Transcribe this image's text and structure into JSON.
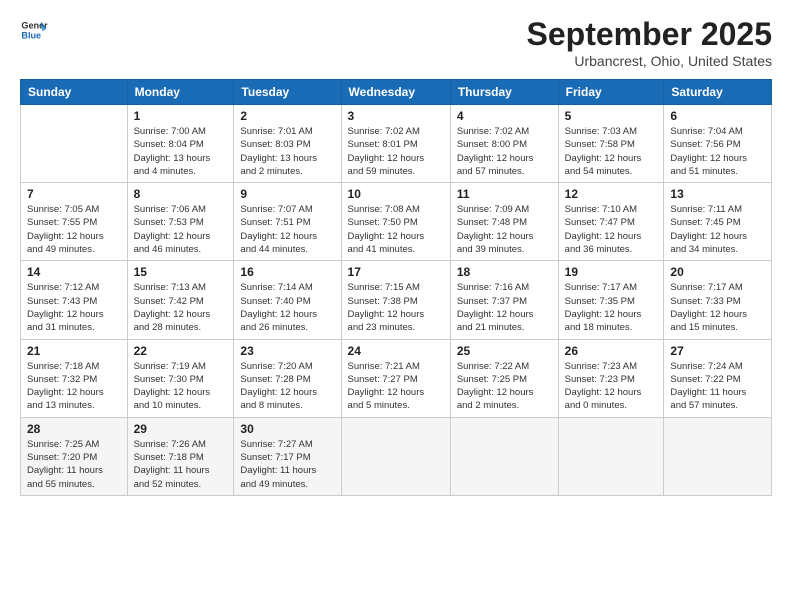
{
  "header": {
    "logo_line1": "General",
    "logo_line2": "Blue",
    "month": "September 2025",
    "location": "Urbancrest, Ohio, United States"
  },
  "weekdays": [
    "Sunday",
    "Monday",
    "Tuesday",
    "Wednesday",
    "Thursday",
    "Friday",
    "Saturday"
  ],
  "weeks": [
    [
      {
        "day": "",
        "info": ""
      },
      {
        "day": "1",
        "info": "Sunrise: 7:00 AM\nSunset: 8:04 PM\nDaylight: 13 hours\nand 4 minutes."
      },
      {
        "day": "2",
        "info": "Sunrise: 7:01 AM\nSunset: 8:03 PM\nDaylight: 13 hours\nand 2 minutes."
      },
      {
        "day": "3",
        "info": "Sunrise: 7:02 AM\nSunset: 8:01 PM\nDaylight: 12 hours\nand 59 minutes."
      },
      {
        "day": "4",
        "info": "Sunrise: 7:02 AM\nSunset: 8:00 PM\nDaylight: 12 hours\nand 57 minutes."
      },
      {
        "day": "5",
        "info": "Sunrise: 7:03 AM\nSunset: 7:58 PM\nDaylight: 12 hours\nand 54 minutes."
      },
      {
        "day": "6",
        "info": "Sunrise: 7:04 AM\nSunset: 7:56 PM\nDaylight: 12 hours\nand 51 minutes."
      }
    ],
    [
      {
        "day": "7",
        "info": "Sunrise: 7:05 AM\nSunset: 7:55 PM\nDaylight: 12 hours\nand 49 minutes."
      },
      {
        "day": "8",
        "info": "Sunrise: 7:06 AM\nSunset: 7:53 PM\nDaylight: 12 hours\nand 46 minutes."
      },
      {
        "day": "9",
        "info": "Sunrise: 7:07 AM\nSunset: 7:51 PM\nDaylight: 12 hours\nand 44 minutes."
      },
      {
        "day": "10",
        "info": "Sunrise: 7:08 AM\nSunset: 7:50 PM\nDaylight: 12 hours\nand 41 minutes."
      },
      {
        "day": "11",
        "info": "Sunrise: 7:09 AM\nSunset: 7:48 PM\nDaylight: 12 hours\nand 39 minutes."
      },
      {
        "day": "12",
        "info": "Sunrise: 7:10 AM\nSunset: 7:47 PM\nDaylight: 12 hours\nand 36 minutes."
      },
      {
        "day": "13",
        "info": "Sunrise: 7:11 AM\nSunset: 7:45 PM\nDaylight: 12 hours\nand 34 minutes."
      }
    ],
    [
      {
        "day": "14",
        "info": "Sunrise: 7:12 AM\nSunset: 7:43 PM\nDaylight: 12 hours\nand 31 minutes."
      },
      {
        "day": "15",
        "info": "Sunrise: 7:13 AM\nSunset: 7:42 PM\nDaylight: 12 hours\nand 28 minutes."
      },
      {
        "day": "16",
        "info": "Sunrise: 7:14 AM\nSunset: 7:40 PM\nDaylight: 12 hours\nand 26 minutes."
      },
      {
        "day": "17",
        "info": "Sunrise: 7:15 AM\nSunset: 7:38 PM\nDaylight: 12 hours\nand 23 minutes."
      },
      {
        "day": "18",
        "info": "Sunrise: 7:16 AM\nSunset: 7:37 PM\nDaylight: 12 hours\nand 21 minutes."
      },
      {
        "day": "19",
        "info": "Sunrise: 7:17 AM\nSunset: 7:35 PM\nDaylight: 12 hours\nand 18 minutes."
      },
      {
        "day": "20",
        "info": "Sunrise: 7:17 AM\nSunset: 7:33 PM\nDaylight: 12 hours\nand 15 minutes."
      }
    ],
    [
      {
        "day": "21",
        "info": "Sunrise: 7:18 AM\nSunset: 7:32 PM\nDaylight: 12 hours\nand 13 minutes."
      },
      {
        "day": "22",
        "info": "Sunrise: 7:19 AM\nSunset: 7:30 PM\nDaylight: 12 hours\nand 10 minutes."
      },
      {
        "day": "23",
        "info": "Sunrise: 7:20 AM\nSunset: 7:28 PM\nDaylight: 12 hours\nand 8 minutes."
      },
      {
        "day": "24",
        "info": "Sunrise: 7:21 AM\nSunset: 7:27 PM\nDaylight: 12 hours\nand 5 minutes."
      },
      {
        "day": "25",
        "info": "Sunrise: 7:22 AM\nSunset: 7:25 PM\nDaylight: 12 hours\nand 2 minutes."
      },
      {
        "day": "26",
        "info": "Sunrise: 7:23 AM\nSunset: 7:23 PM\nDaylight: 12 hours\nand 0 minutes."
      },
      {
        "day": "27",
        "info": "Sunrise: 7:24 AM\nSunset: 7:22 PM\nDaylight: 11 hours\nand 57 minutes."
      }
    ],
    [
      {
        "day": "28",
        "info": "Sunrise: 7:25 AM\nSunset: 7:20 PM\nDaylight: 11 hours\nand 55 minutes."
      },
      {
        "day": "29",
        "info": "Sunrise: 7:26 AM\nSunset: 7:18 PM\nDaylight: 11 hours\nand 52 minutes."
      },
      {
        "day": "30",
        "info": "Sunrise: 7:27 AM\nSunset: 7:17 PM\nDaylight: 11 hours\nand 49 minutes."
      },
      {
        "day": "",
        "info": ""
      },
      {
        "day": "",
        "info": ""
      },
      {
        "day": "",
        "info": ""
      },
      {
        "day": "",
        "info": ""
      }
    ]
  ]
}
